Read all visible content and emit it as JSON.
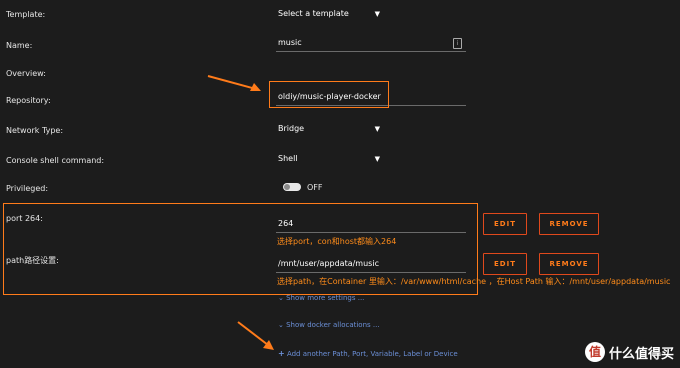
{
  "rows": {
    "template": {
      "label": "Template:",
      "value": "Select a template"
    },
    "name": {
      "label": "Name:",
      "value": "music"
    },
    "overview": {
      "label": "Overview:"
    },
    "repository": {
      "label": "Repository:",
      "value": "oldiy/music-player-docker"
    },
    "network_type": {
      "label": "Network Type:",
      "value": "Bridge"
    },
    "console_shell": {
      "label": "Console shell command:",
      "value": "Shell"
    },
    "privileged": {
      "label": "Privileged:",
      "state": "OFF"
    }
  },
  "port": {
    "label": "port 264:",
    "value": "264",
    "hint": "选择port，con和host都输入264",
    "edit": "EDIT",
    "remove": "REMOVE"
  },
  "path": {
    "label": "path路径设置:",
    "value": "/mnt/user/appdata/music",
    "hint": "选择path，在Container 里输入：/var/www/html/cache ，在Host Path 输入：/mnt/user/appdata/music",
    "edit": "EDIT",
    "remove": "REMOVE"
  },
  "links": {
    "show_more": "Show more settings ...",
    "show_docker": "Show docker allocations ...",
    "add_another": "Add another Path, Port, Variable, Label or Device"
  },
  "watermark": {
    "badge": "值",
    "text": "什么值得买"
  },
  "colors": {
    "accent": "#ff7b1a",
    "link": "#6b8fd6",
    "background": "#1c1c1c"
  }
}
